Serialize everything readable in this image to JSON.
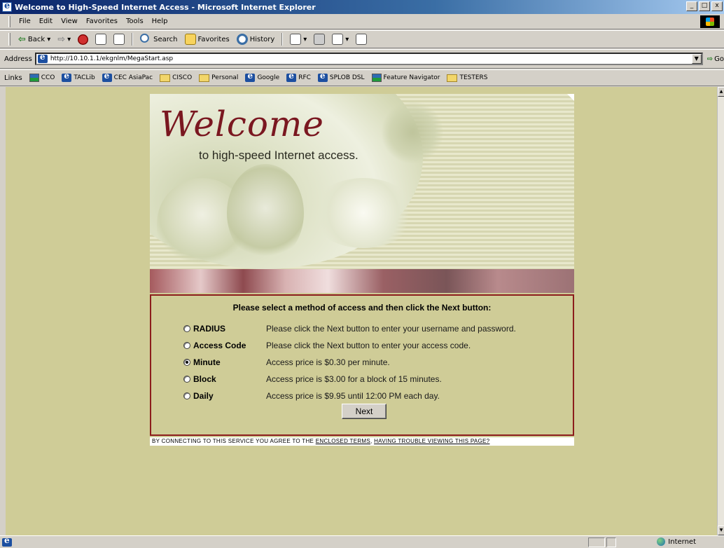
{
  "window": {
    "title": "Welcome to High-Speed Internet Access - Microsoft Internet Explorer",
    "minimize": "_",
    "maximize": "□",
    "close": "x"
  },
  "menu": [
    "File",
    "Edit",
    "View",
    "Favorites",
    "Tools",
    "Help"
  ],
  "toolbar": {
    "back": "Back",
    "search": "Search",
    "favorites": "Favorites",
    "history": "History"
  },
  "address": {
    "label": "Address",
    "url": "http://10.10.1.1/ekgnlm/MegaStart.asp",
    "go": "Go"
  },
  "links": {
    "label": "Links",
    "items": [
      "CCO",
      "TACLib",
      "CEC AsiaPac",
      "CISCO",
      "Personal",
      "Google",
      "RFC",
      "SPLOB DSL",
      "Feature Navigator",
      "TESTERS"
    ]
  },
  "banner": {
    "welcome": "Welcome",
    "subtitle": "to high-speed Internet access."
  },
  "panel": {
    "title": "Please select a method of access and then click the Next button:",
    "options": [
      {
        "label": "RADIUS",
        "description": "Please click the Next button to enter your username and password.",
        "checked": false
      },
      {
        "label": "Access Code",
        "description": "Please click the Next button to enter your access code.",
        "checked": false
      },
      {
        "label": "Minute",
        "description": "Access price is $0.30 per minute.",
        "checked": true
      },
      {
        "label": "Block",
        "description": "Access price is $3.00 for a block of 15 minutes.",
        "checked": false
      },
      {
        "label": "Daily",
        "description": "Access price is $9.95 until 12:00 PM each day.",
        "checked": false
      }
    ],
    "next_label": "Next"
  },
  "footer": {
    "text": "BY CONNECTING TO THIS SERVICE YOU AGREE TO THE",
    "terms_link": "ENCLOSED TERMS",
    "trouble_link": "HAVING TROUBLE VIEWING THIS PAGE?"
  },
  "status": {
    "zone": "Internet"
  },
  "colors": {
    "page_bg": "#cfcc97",
    "accent": "#7a1720",
    "panel_border": "#8c1c1c"
  }
}
